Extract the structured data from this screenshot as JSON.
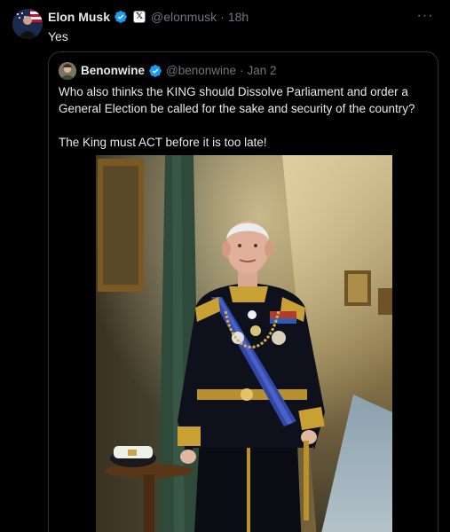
{
  "post": {
    "author_name": "Elon Musk",
    "author_handle": "@elonmusk",
    "separator": "·",
    "time": "18h",
    "affiliation_badge": "𝕏",
    "more_label": "···",
    "text": "Yes"
  },
  "quote": {
    "author_name": "Benonwine",
    "author_handle": "@benonwine",
    "separator": "·",
    "time": "Jan 2",
    "paragraphs": [
      "Who also thinks the KING should Dissolve Parliament and order a General Election be called for the sake and security of the country?",
      "The King must ACT before it is too late!"
    ]
  },
  "colors": {
    "background": "#000000",
    "text": "#e7e9ea",
    "muted": "#71767b",
    "verified": "#1d9bf0",
    "border": "#2f3336"
  },
  "icons": {
    "verified": "verified-checkmark-icon",
    "more": "more-dots-icon",
    "affiliation": "x-logo-icon"
  }
}
